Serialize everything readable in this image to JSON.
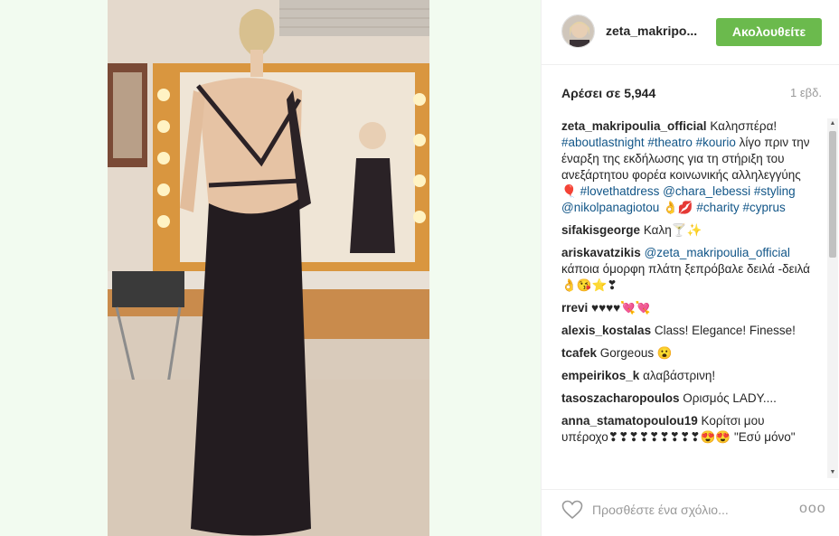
{
  "header": {
    "username": "zeta_makripo...",
    "follow_label": "Ακολουθείτε"
  },
  "stats": {
    "likes": "Αρέσει σε 5,944",
    "time": "1 εβδ."
  },
  "caption": {
    "user": "zeta_makripoulia_official",
    "parts": [
      {
        "text": "Καλησπέρα! ",
        "tag": false
      },
      {
        "text": "#aboutlastnight #theatro #kourio",
        "tag": true
      },
      {
        "text": " λίγο πριν την έναρξη της εκδήλωσης για τη στήριξη του ανεξάρτητου φορέα κοινωνικής αλληλεγγύης🎈 ",
        "tag": false
      },
      {
        "text": "#lovethatdress @chara_lebessi #styling @nikolpanagiotou",
        "tag": true
      },
      {
        "text": " 👌💋 ",
        "tag": false
      },
      {
        "text": "#charity #cyprus",
        "tag": true
      }
    ]
  },
  "comments": [
    {
      "user": "sifakisgeorge",
      "parts": [
        {
          "text": "Καλη🍸✨",
          "tag": false
        }
      ]
    },
    {
      "user": "ariskavatzikis",
      "parts": [
        {
          "text": "@zeta_makripoulia_official",
          "tag": true
        },
        {
          "text": " κάποια όμορφη πλάτη ξεπρόβαλε δειλά -δειλά 👌😘⭐❣",
          "tag": false
        }
      ]
    },
    {
      "user": "rrevi",
      "parts": [
        {
          "text": "♥♥♥♥💘💘",
          "tag": false
        }
      ]
    },
    {
      "user": "alexis_kostalas",
      "parts": [
        {
          "text": "Class! Elegance! Finesse!",
          "tag": false
        }
      ]
    },
    {
      "user": "tcafek",
      "parts": [
        {
          "text": "Gorgeous 😮",
          "tag": false
        }
      ]
    },
    {
      "user": "empeirikos_k",
      "parts": [
        {
          "text": "αλαβάστρινη!",
          "tag": false
        }
      ]
    },
    {
      "user": "tasoszacharopoulos",
      "parts": [
        {
          "text": "Ορισμός LADY....",
          "tag": false
        }
      ]
    },
    {
      "user": "anna_stamatopoulou19",
      "parts": [
        {
          "text": "Κορίτσι μου υπέροχο❣❣❣❣❣❣❣❣❣😍😍 \"Εσύ μόνο\"",
          "tag": false
        }
      ]
    }
  ],
  "footer": {
    "comment_placeholder": "Προσθέστε ένα σχόλιο...",
    "more_label": "ooo"
  },
  "colors": {
    "follow_button": "#6bba4d",
    "hashtag": "#125688",
    "background": "#f2fbf0"
  },
  "icons": {
    "like": "heart-outline-icon",
    "more": "ellipsis-icon"
  }
}
